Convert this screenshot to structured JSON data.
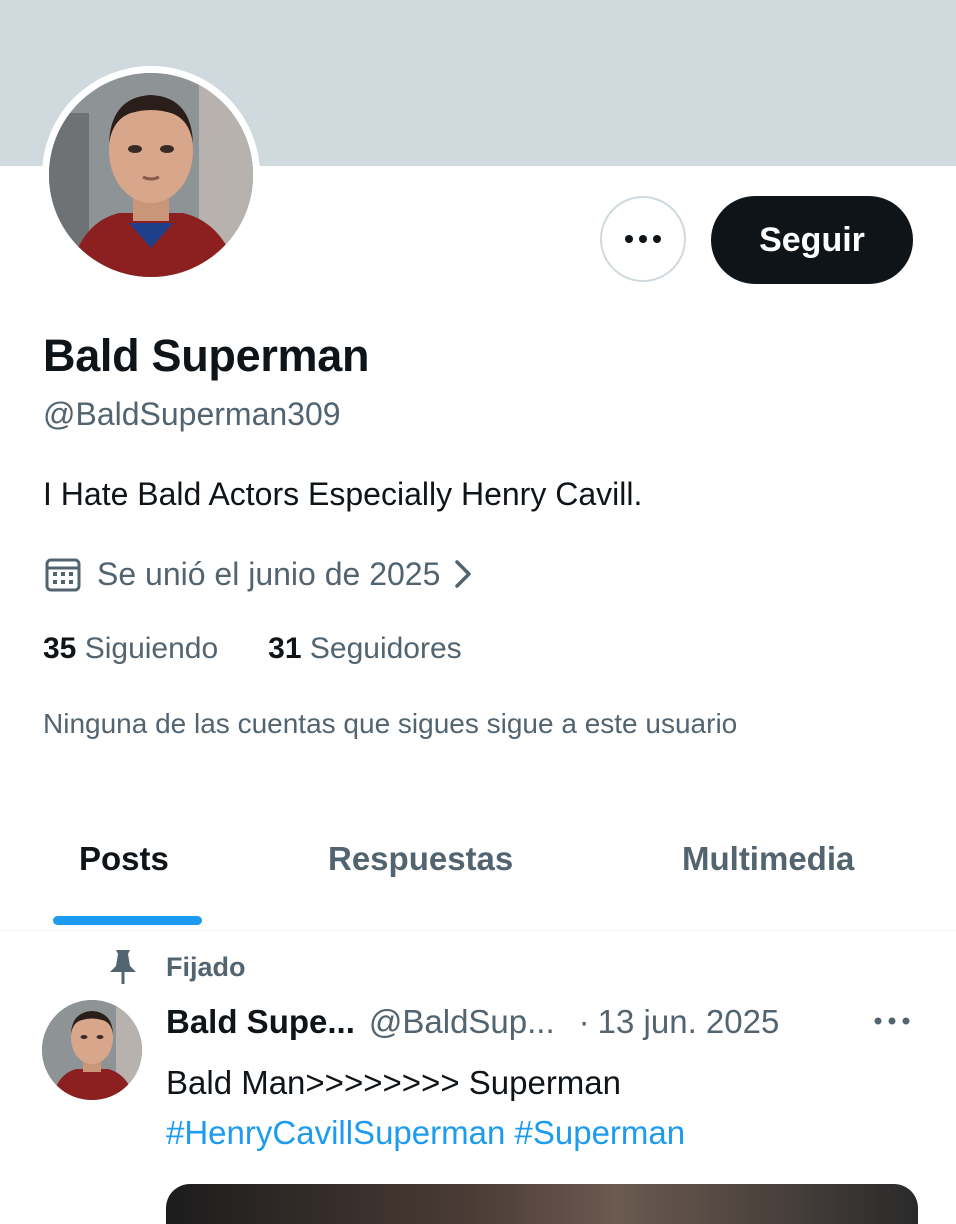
{
  "profile": {
    "display_name": "Bald Superman",
    "handle": "@BaldSuperman309",
    "bio": "I Hate Bald Actors Especially Henry Cavill.",
    "joined": "Se unió el junio de 2025",
    "following_count": "35",
    "following_label": "Siguiendo",
    "followers_count": "31",
    "followers_label": "Seguidores",
    "followed_by_note": "Ninguna de las cuentas que sigues sigue a este usuario"
  },
  "actions": {
    "more_icon": "more-horizontal-icon",
    "follow_label": "Seguir"
  },
  "tabs": [
    {
      "label": "Posts",
      "active": true
    },
    {
      "label": "Respuestas",
      "active": false
    },
    {
      "label": "Multimedia",
      "active": false
    }
  ],
  "pinned_post": {
    "pinned_label": "Fijado",
    "author_name": "Bald Supe...",
    "author_handle": "@BaldSup...",
    "separator": "·",
    "date": "13 jun. 2025",
    "text": "Bald Man>>>>>>>> Superman",
    "hashtags": [
      "#HenryCavillSuperman",
      "#Superman"
    ]
  },
  "colors": {
    "banner": "#cfd9de",
    "accent": "#1d9bf0",
    "text_primary": "#0f1419",
    "text_secondary": "#536471",
    "button_dark": "#0f1419"
  },
  "icons": [
    "calendar-icon",
    "chevron-right-icon",
    "pin-icon",
    "more-horizontal-icon"
  ]
}
